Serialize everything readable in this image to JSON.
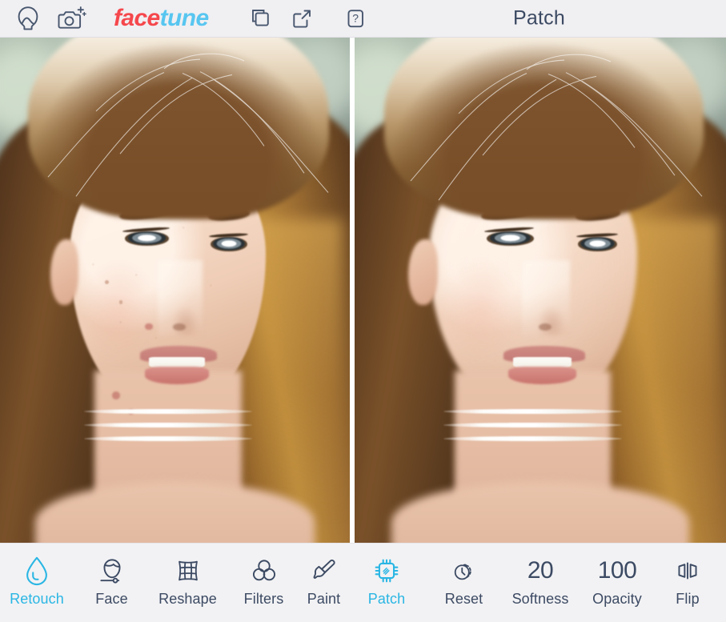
{
  "header": {
    "title": "Patch",
    "logo": {
      "part1": "face",
      "part2": "tune",
      "color1": "#f5474c",
      "color2": "#57c6f0"
    },
    "icons": [
      {
        "name": "photos-icon",
        "label": "Photos"
      },
      {
        "name": "camera-add-icon",
        "label": "Camera"
      },
      {
        "name": "copy-layers-icon",
        "label": "Duplicate"
      },
      {
        "name": "share-export-icon",
        "label": "Share"
      },
      {
        "name": "help-icon",
        "label": "?"
      }
    ],
    "help_glyph": "?",
    "bg_color": "#f0eff2",
    "title_color": "#3c4a63"
  },
  "canvas": {
    "before": {
      "name": "before-photo",
      "alt": "Portrait of a young woman before retouching, visible blemishes and freckles"
    },
    "after": {
      "name": "after-photo",
      "alt": "Portrait of the same woman after Patch retouching, smoothed skin"
    },
    "divider": "#ffffff"
  },
  "toolbar": {
    "active_color": "#2ab6e4",
    "inactive_color": "#3c4a63",
    "bg_color": "#f2f2f4",
    "items": [
      {
        "id": "retouch",
        "label": "Retouch",
        "icon": "droplet-icon",
        "active": true,
        "type": "icon"
      },
      {
        "id": "face",
        "label": "Face",
        "icon": "face-slider-icon",
        "active": false,
        "type": "icon"
      },
      {
        "id": "reshape",
        "label": "Reshape",
        "icon": "grid-mesh-icon",
        "active": false,
        "type": "icon"
      },
      {
        "id": "filters",
        "label": "Filters",
        "icon": "three-circles-icon",
        "active": false,
        "type": "icon"
      },
      {
        "id": "paint",
        "label": "Paint",
        "icon": "paintbrush-icon",
        "active": false,
        "type": "icon"
      },
      {
        "id": "patch",
        "label": "Patch",
        "icon": "patch-chip-icon",
        "active": true,
        "type": "icon"
      },
      {
        "id": "reset",
        "label": "Reset",
        "icon": "reset-clock-icon",
        "active": false,
        "type": "icon"
      },
      {
        "id": "softness",
        "label": "Softness",
        "value": "20",
        "active": false,
        "type": "value"
      },
      {
        "id": "opacity",
        "label": "Opacity",
        "value": "100",
        "active": false,
        "type": "value"
      },
      {
        "id": "flip",
        "label": "Flip",
        "icon": "flip-horizontal-icon",
        "active": false,
        "type": "icon"
      }
    ]
  }
}
